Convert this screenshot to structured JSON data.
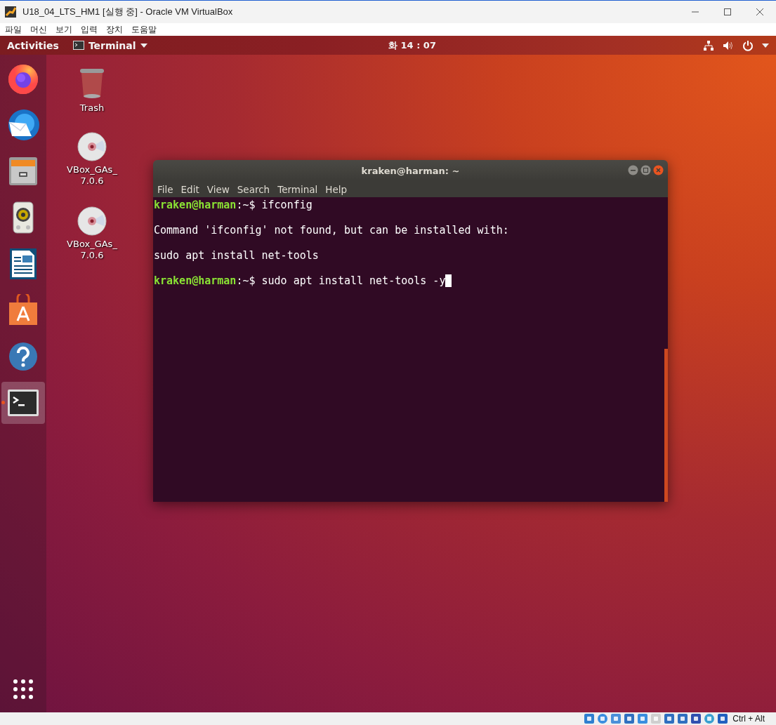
{
  "host_window": {
    "title": "U18_04_LTS_HM1 [실행 중] - Oracle VM VirtualBox",
    "menu": [
      "파일",
      "머신",
      "보기",
      "입력",
      "장치",
      "도움말"
    ]
  },
  "top_panel": {
    "activities": "Activities",
    "app_menu": "Terminal",
    "clock": "화 14 : 07"
  },
  "dock": [
    {
      "kind": "firefox",
      "selected": false
    },
    {
      "kind": "thunderbird",
      "selected": false
    },
    {
      "kind": "files",
      "selected": false
    },
    {
      "kind": "rhythmbox",
      "selected": false
    },
    {
      "kind": "writer",
      "selected": false
    },
    {
      "kind": "software",
      "selected": false
    },
    {
      "kind": "help",
      "selected": false
    },
    {
      "kind": "terminal",
      "selected": true
    }
  ],
  "desktop_icons": [
    {
      "kind": "trash",
      "label_lines": [
        "Trash"
      ]
    },
    {
      "kind": "disc",
      "label_lines": [
        "VBox_GAs_",
        "7.0.6"
      ]
    },
    {
      "kind": "disc",
      "label_lines": [
        "VBox_GAs_",
        "7.0.6"
      ]
    }
  ],
  "terminal": {
    "title": "kraken@harman: ~",
    "menu": [
      "File",
      "Edit",
      "View",
      "Search",
      "Terminal",
      "Help"
    ],
    "lines": [
      {
        "kind": "prompt",
        "user": "kraken@harman",
        "path": ":~$ ",
        "command": "ifconfig",
        "cursor": false
      },
      {
        "kind": "blank"
      },
      {
        "kind": "output",
        "text": "Command 'ifconfig' not found, but can be installed with:"
      },
      {
        "kind": "blank"
      },
      {
        "kind": "output",
        "text": "sudo apt install net-tools"
      },
      {
        "kind": "blank"
      },
      {
        "kind": "prompt",
        "user": "kraken@harman",
        "path": ":~$ ",
        "command": "sudo apt install net-tools -y",
        "cursor": true
      }
    ]
  },
  "status_bar": {
    "keys": "Ctrl + Alt"
  }
}
